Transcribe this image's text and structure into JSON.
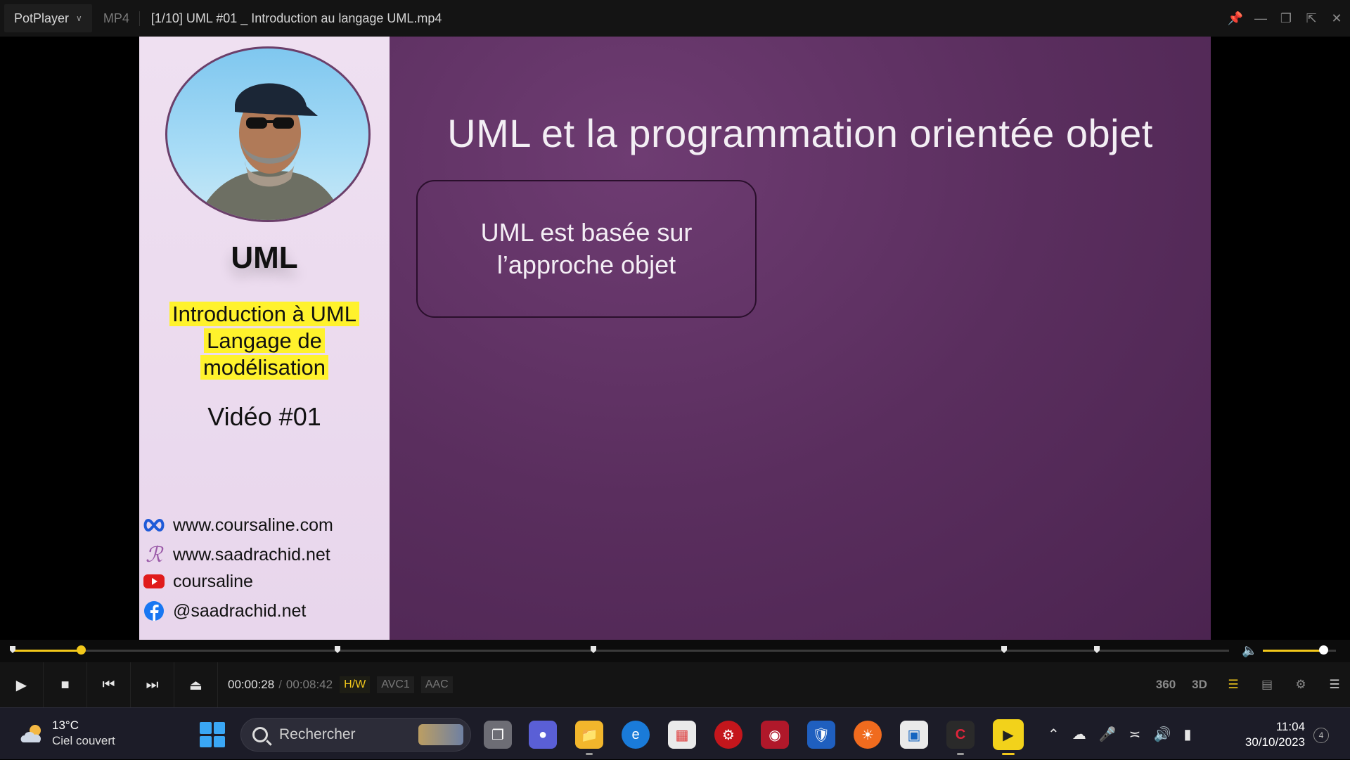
{
  "titlebar": {
    "app_name": "PotPlayer",
    "format": "MP4",
    "file_title": "[1/10] UML #01 _ Introduction au langage UML.mp4"
  },
  "slide": {
    "left": {
      "heading": "UML",
      "intro_lines": [
        "Introduction à UML",
        "Langage de",
        "modélisation"
      ],
      "video_number": "Vidéo #01",
      "links": [
        {
          "icon": "coursaline-logo-icon",
          "text": "www.coursaline.com"
        },
        {
          "icon": "sr-logo-icon",
          "text": "www.saadrachid.net"
        },
        {
          "icon": "youtube-icon",
          "text": "coursaline"
        },
        {
          "icon": "facebook-icon",
          "text": "@saadrachid.net"
        }
      ]
    },
    "title": "UML et la programmation orientée objet",
    "callout_lines": [
      "UML est basée sur",
      "l’approche objet"
    ]
  },
  "player": {
    "progress_fraction": 0.056,
    "volume_fraction": 0.83,
    "time_current": "00:00:28",
    "time_separator": "/",
    "time_total": "00:08:42",
    "badges": [
      "H/W",
      "AVC1",
      "AAC"
    ],
    "right_controls": [
      "360",
      "3D"
    ],
    "accent_color": "#f2c81b"
  },
  "taskbar": {
    "weather_temp": "13°C",
    "weather_desc": "Ciel couvert",
    "search_placeholder": "Rechercher",
    "clock_time": "11:04",
    "clock_date": "30/10/2023",
    "notification_count": "4"
  }
}
